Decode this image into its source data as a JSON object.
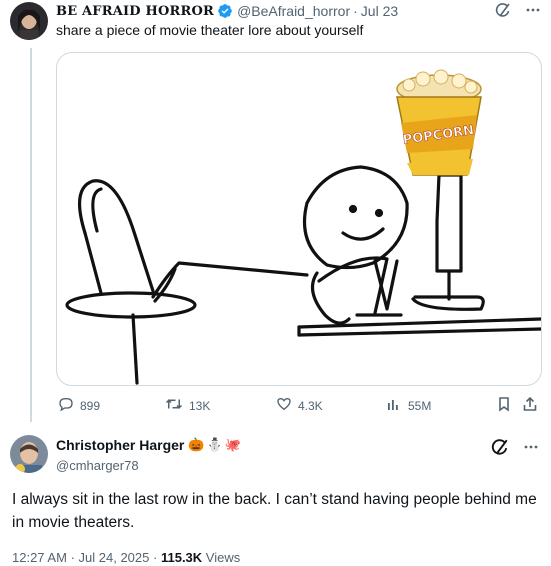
{
  "colors": {
    "verified": "#1d9bf0",
    "text": "#0f1419",
    "muted": "#536471",
    "border": "#cfd9de"
  },
  "original_tweet": {
    "author_name": "BE AFRAID HORROR",
    "handle": "@BeAfraid_horror",
    "dot": "·",
    "date": "Jul 23",
    "text": "share a piece of movie theater lore about yourself",
    "media": {
      "icon": "meme-image",
      "popcorn_label": "POPCORN"
    },
    "metrics": {
      "replies": "899",
      "retweets": "13K",
      "likes": "4.3K",
      "views": "55M"
    }
  },
  "reply": {
    "author_name": "Christopher Harger",
    "emojis": [
      "🎃",
      "⛄",
      "🐙"
    ],
    "handle": "@cmharger78",
    "text": "I always sit in the last row in the back. I can’t stand having people behind me in movie theaters.",
    "time": "12:27 AM",
    "dot": "·",
    "date": "Jul 24, 2025",
    "dot2": "·",
    "views_count": "115.3K",
    "views_label": "Views"
  }
}
